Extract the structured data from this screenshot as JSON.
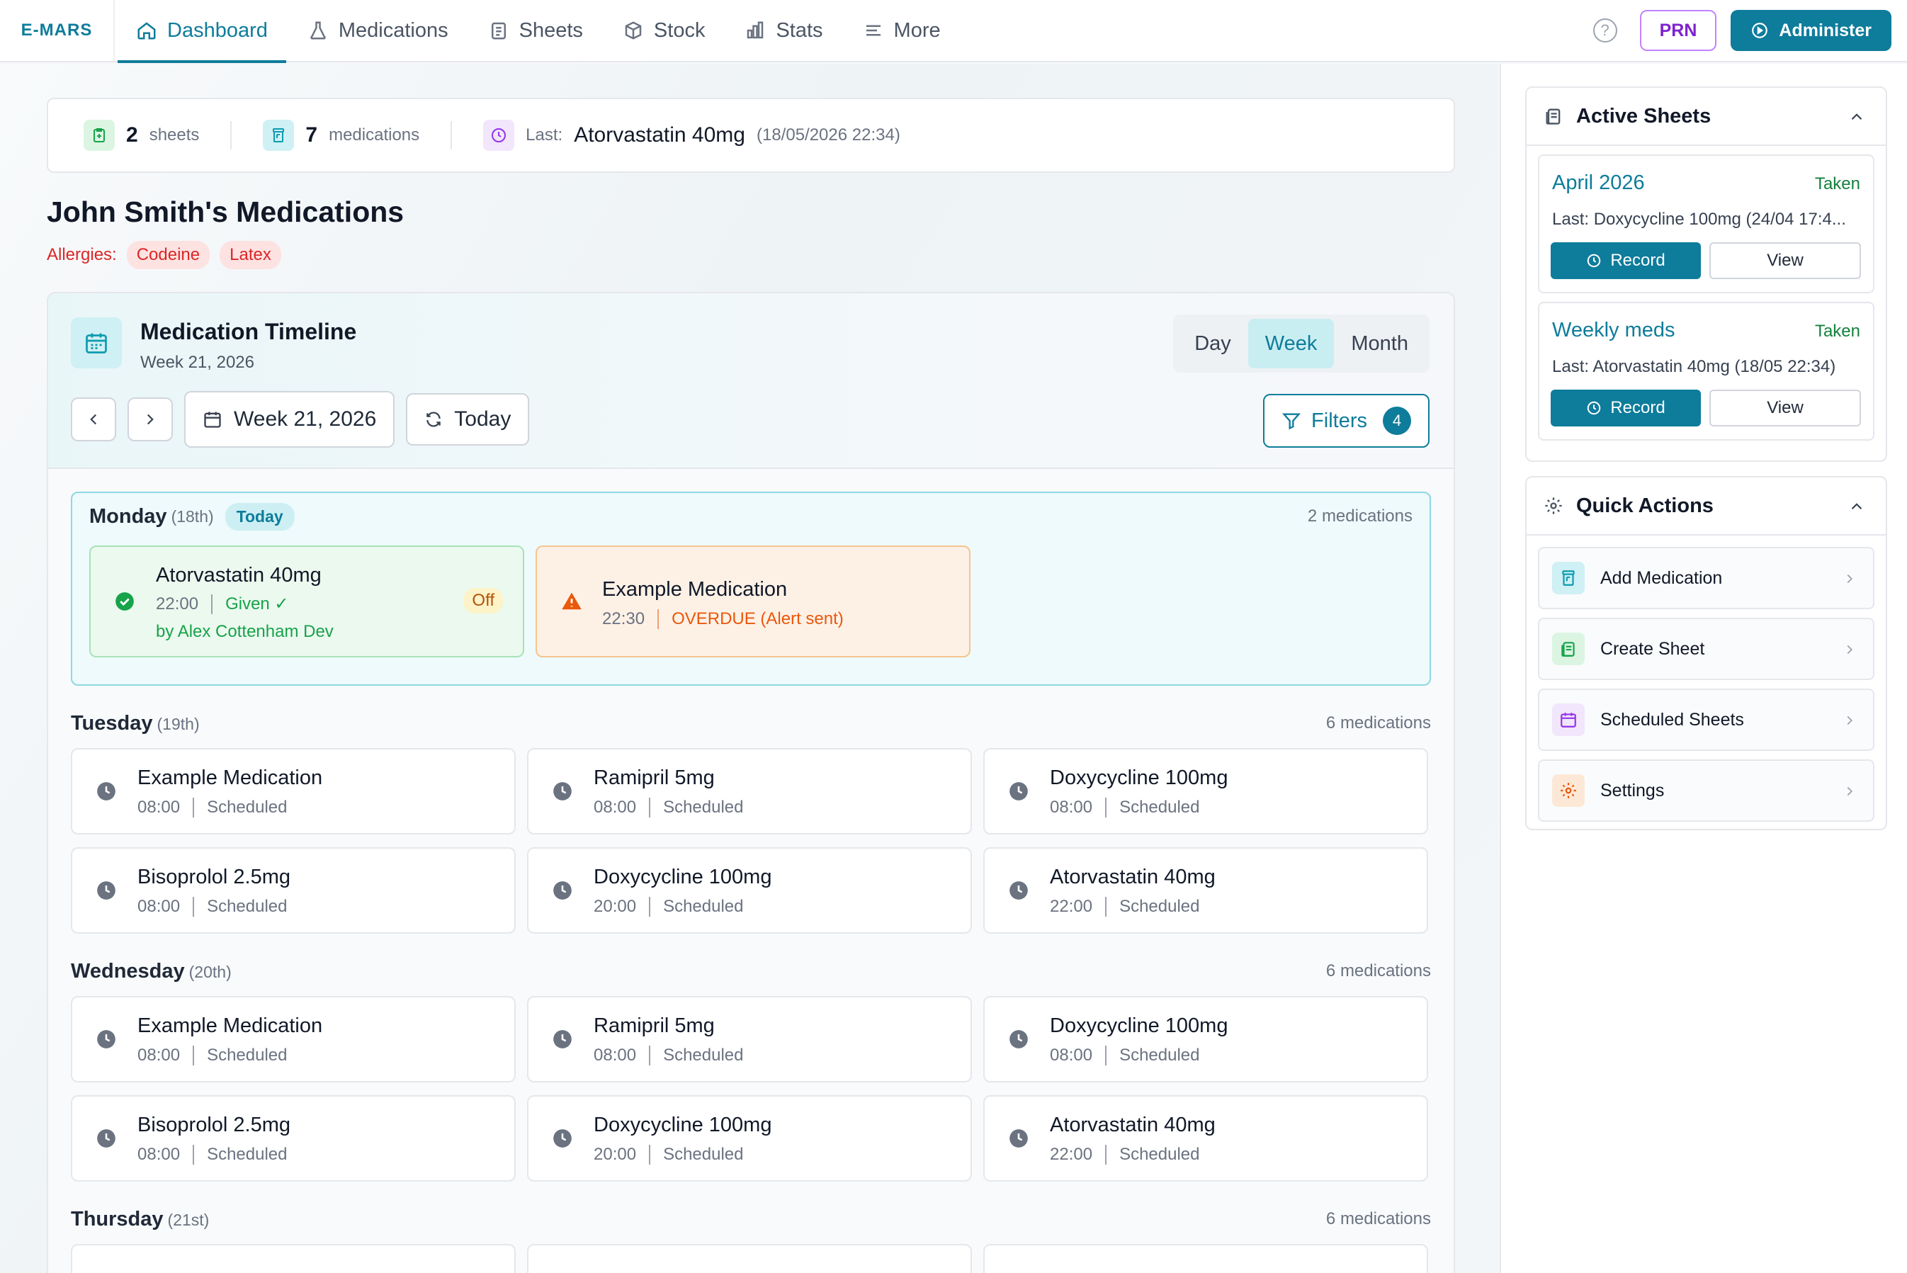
{
  "nav": {
    "brand": "E-MARS",
    "tabs": [
      {
        "label": "Dashboard",
        "icon": "home-icon"
      },
      {
        "label": "Medications",
        "icon": "flask-icon"
      },
      {
        "label": "Sheets",
        "icon": "sheets-icon"
      },
      {
        "label": "Stock",
        "icon": "box-icon"
      },
      {
        "label": "Stats",
        "icon": "bar-chart-icon"
      },
      {
        "label": "More",
        "icon": "menu-icon"
      }
    ],
    "active_tab": "Dashboard",
    "help": "?",
    "prn_label": "PRN",
    "administer_label": "Administer"
  },
  "summary": {
    "sheets_count": "2",
    "sheets_label": "sheets",
    "meds_count": "7",
    "meds_label": "medications",
    "last_label": "Last:",
    "last_med": "Atorvastatin 40mg",
    "last_date": "(18/05/2026 22:34)"
  },
  "patient": {
    "title": "John Smith's Medications",
    "allergies_label": "Allergies:",
    "allergies": [
      "Codeine",
      "Latex"
    ]
  },
  "timeline": {
    "title": "Medication Timeline",
    "subtitle": "Week 21, 2026",
    "views": [
      "Day",
      "Week",
      "Month"
    ],
    "active_view": "Week",
    "week_label": "Week 21, 2026",
    "today_label": "Today",
    "filters_label": "Filters",
    "filters_count": "4",
    "days": [
      {
        "name": "Monday",
        "date": "(18th)",
        "today_chip": "Today",
        "count": "2 medications",
        "meds": [
          {
            "name": "Atorvastatin 40mg",
            "time": "22:00",
            "status": "Given ✓",
            "by": "by Alex Cottenham Dev",
            "tag": "Off",
            "kind": "given"
          },
          {
            "name": "Example Medication",
            "time": "22:30",
            "status": "OVERDUE (Alert sent)",
            "kind": "overdue"
          }
        ]
      },
      {
        "name": "Tuesday",
        "date": "(19th)",
        "count": "6 medications",
        "meds": [
          {
            "name": "Example Medication",
            "time": "08:00",
            "status": "Scheduled"
          },
          {
            "name": "Ramipril 5mg",
            "time": "08:00",
            "status": "Scheduled"
          },
          {
            "name": "Doxycycline 100mg",
            "time": "08:00",
            "status": "Scheduled"
          },
          {
            "name": "Bisoprolol 2.5mg",
            "time": "08:00",
            "status": "Scheduled"
          },
          {
            "name": "Doxycycline 100mg",
            "time": "20:00",
            "status": "Scheduled"
          },
          {
            "name": "Atorvastatin 40mg",
            "time": "22:00",
            "status": "Scheduled"
          }
        ]
      },
      {
        "name": "Wednesday",
        "date": "(20th)",
        "count": "6 medications",
        "meds": [
          {
            "name": "Example Medication",
            "time": "08:00",
            "status": "Scheduled"
          },
          {
            "name": "Ramipril 5mg",
            "time": "08:00",
            "status": "Scheduled"
          },
          {
            "name": "Doxycycline 100mg",
            "time": "08:00",
            "status": "Scheduled"
          },
          {
            "name": "Bisoprolol 2.5mg",
            "time": "08:00",
            "status": "Scheduled"
          },
          {
            "name": "Doxycycline 100mg",
            "time": "20:00",
            "status": "Scheduled"
          },
          {
            "name": "Atorvastatin 40mg",
            "time": "22:00",
            "status": "Scheduled"
          }
        ]
      },
      {
        "name": "Thursday",
        "date": "(21st)",
        "count": "6 medications"
      }
    ]
  },
  "sidebar": {
    "active_sheets": {
      "title": "Active Sheets",
      "sheets": [
        {
          "name": "April 2026",
          "status": "Taken",
          "last": "Last: Doxycycline 100mg (24/04 17:4...",
          "record": "Record",
          "view": "View"
        },
        {
          "name": "Weekly meds",
          "status": "Taken",
          "last": "Last: Atorvastatin 40mg (18/05 22:34)",
          "record": "Record",
          "view": "View"
        }
      ]
    },
    "quick_actions": {
      "title": "Quick Actions",
      "items": [
        {
          "label": "Add Medication",
          "icon": "pill-bottle-icon",
          "color": "#0e9bb0"
        },
        {
          "label": "Create Sheet",
          "icon": "clipboard-icon",
          "color": "#16a34a"
        },
        {
          "label": "Scheduled Sheets",
          "icon": "calendar-icon",
          "color": "#9333ea"
        },
        {
          "label": "Settings",
          "icon": "gear-icon",
          "color": "#ea580c"
        }
      ]
    }
  },
  "colors": {
    "accent": "#0e7c9b",
    "given": "#16a34a",
    "overdue": "#ea580c",
    "allergy": "#dc2626",
    "prn": "#7e22ce"
  }
}
